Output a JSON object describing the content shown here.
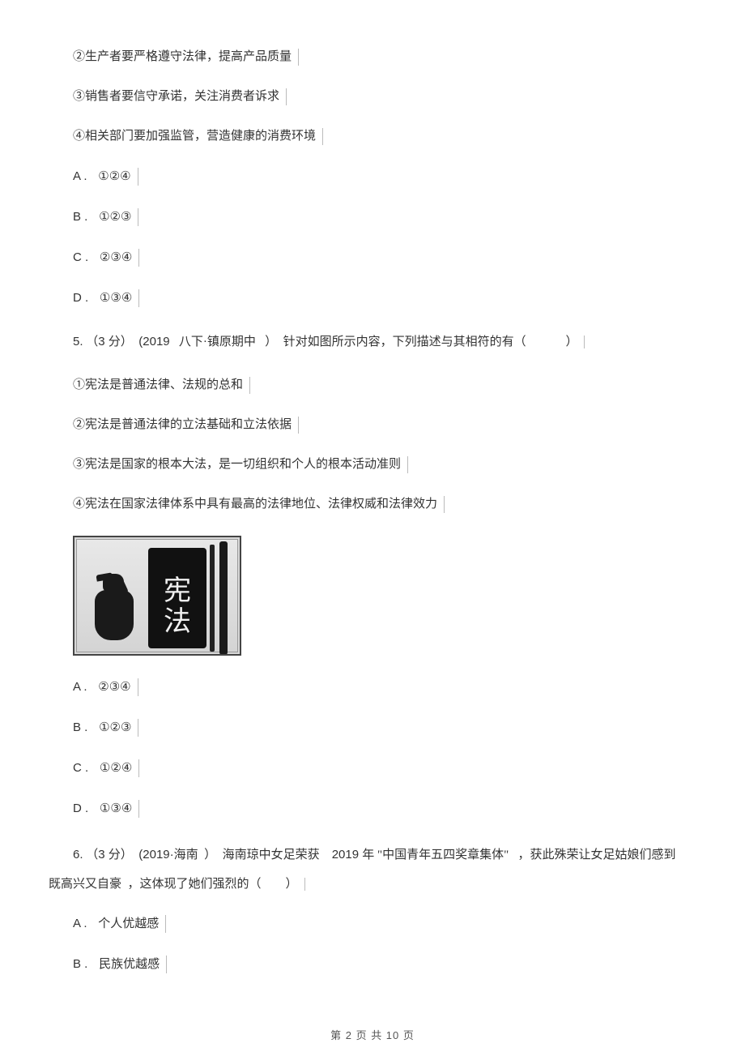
{
  "q4": {
    "s2": "②生产者要严格遵守法律，提高产品质量",
    "s3": "③销售者要信守承诺，关注消费者诉求",
    "s4": "④相关部门要加强监管，营造健康的消费环境",
    "options": {
      "A": "①②④",
      "B": "①②③",
      "C": "②③④",
      "D": "①③④"
    }
  },
  "q5": {
    "num": "5.",
    "points": "（3 分）",
    "source": "(2019",
    "source2": "八下·镇原期中",
    "source3": "）",
    "stem_a": "针对如图所示内容，下列描述与其相符的有（",
    "stem_b": "）",
    "s1": "①宪法是普通法律、法规的总和",
    "s2": "②宪法是普通法律的立法基础和立法依据",
    "s3": "③宪法是国家的根本大法，是一切组织和个人的根本活动准则",
    "s4": "④宪法在国家法律体系中具有最高的法律地位、法律权威和法律效力",
    "image_text_top": "宪",
    "image_text_bot": "法",
    "options": {
      "A": "②③④",
      "B": "①②③",
      "C": "①②④",
      "D": "①③④"
    }
  },
  "q6": {
    "num": "6.",
    "points": "（3 分）",
    "source": "(2019·海南",
    "source2": "）",
    "stem_a": "海南琼中女足荣获",
    "stem_year": "2019 年",
    "stem_b": "\"中国青年五四奖章集体\"",
    "stem_c": "，获此殊荣让女足姑娘们感到",
    "stem_line2_a": "既高兴又自豪",
    "stem_line2_b": "，这体现了她们强烈的（",
    "stem_line2_c": "）",
    "options": {
      "A": "个人优越感",
      "B": "民族优越感"
    }
  },
  "labels": {
    "A": "A .",
    "B": "B .",
    "C": "C .",
    "D": "D ."
  },
  "footer": "第 2 页 共 10 页"
}
